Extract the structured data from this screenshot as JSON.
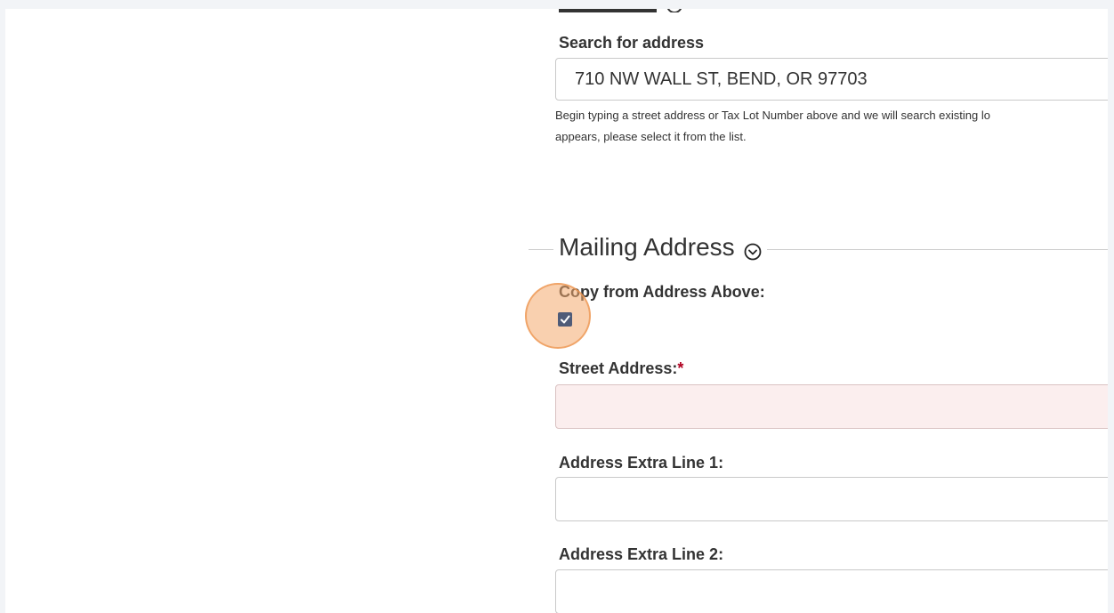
{
  "address_section": {
    "search_label": "Search for address",
    "search_value": "710 NW WALL ST, BEND, OR 97703",
    "help_line1": "Begin typing a street address or Tax Lot Number above and we will search existing lo",
    "help_line2": "appears, please select it from the list."
  },
  "mailing_section": {
    "legend": "Mailing Address",
    "collapse_icon": "chevron-circle-down-icon",
    "copy_label": "Copy from Address Above:",
    "copy_checked": true,
    "street_label": "Street Address:",
    "required_mark": "*",
    "street_value": "",
    "extra1_label": "Address Extra Line 1:",
    "extra1_value": "",
    "extra2_label": "Address Extra Line 2:",
    "extra2_value": ""
  },
  "colors": {
    "checkbox": "#4f5b78",
    "error_field_bg": "#fbeeee",
    "required": "#b00020",
    "click_highlight": "#f4aa6e"
  }
}
